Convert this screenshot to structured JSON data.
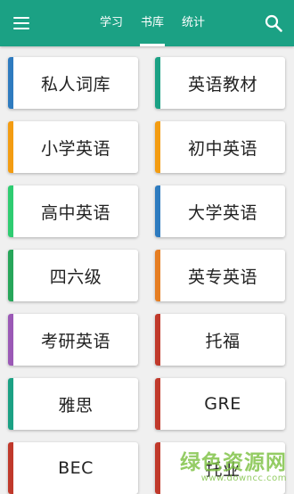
{
  "header": {
    "tabs": [
      {
        "label": "学习",
        "active": false
      },
      {
        "label": "书库",
        "active": true
      },
      {
        "label": "统计",
        "active": false
      }
    ],
    "menu_icon": "hamburger-menu-icon",
    "search_icon": "search-icon",
    "background_color": "#1ba184"
  },
  "books": [
    {
      "label": "私人词库",
      "color": "#2e7bbf"
    },
    {
      "label": "英语教材",
      "color": "#1ba184"
    },
    {
      "label": "小学英语",
      "color": "#f39c12"
    },
    {
      "label": "初中英语",
      "color": "#f39c12"
    },
    {
      "label": "高中英语",
      "color": "#2ecc71"
    },
    {
      "label": "大学英语",
      "color": "#2e7bbf"
    },
    {
      "label": "四六级",
      "color": "#27a65a"
    },
    {
      "label": "英专英语",
      "color": "#e67e22"
    },
    {
      "label": "考研英语",
      "color": "#9b59b6"
    },
    {
      "label": "托福",
      "color": "#c0392b"
    },
    {
      "label": "雅思",
      "color": "#1ba184"
    },
    {
      "label": "GRE",
      "color": "#c0392b"
    },
    {
      "label": "BEC",
      "color": "#c0392b"
    },
    {
      "label": "托业",
      "color": "#c0392b"
    }
  ],
  "watermark": {
    "title": "绿色资源网",
    "url": "www.downcc.com"
  }
}
